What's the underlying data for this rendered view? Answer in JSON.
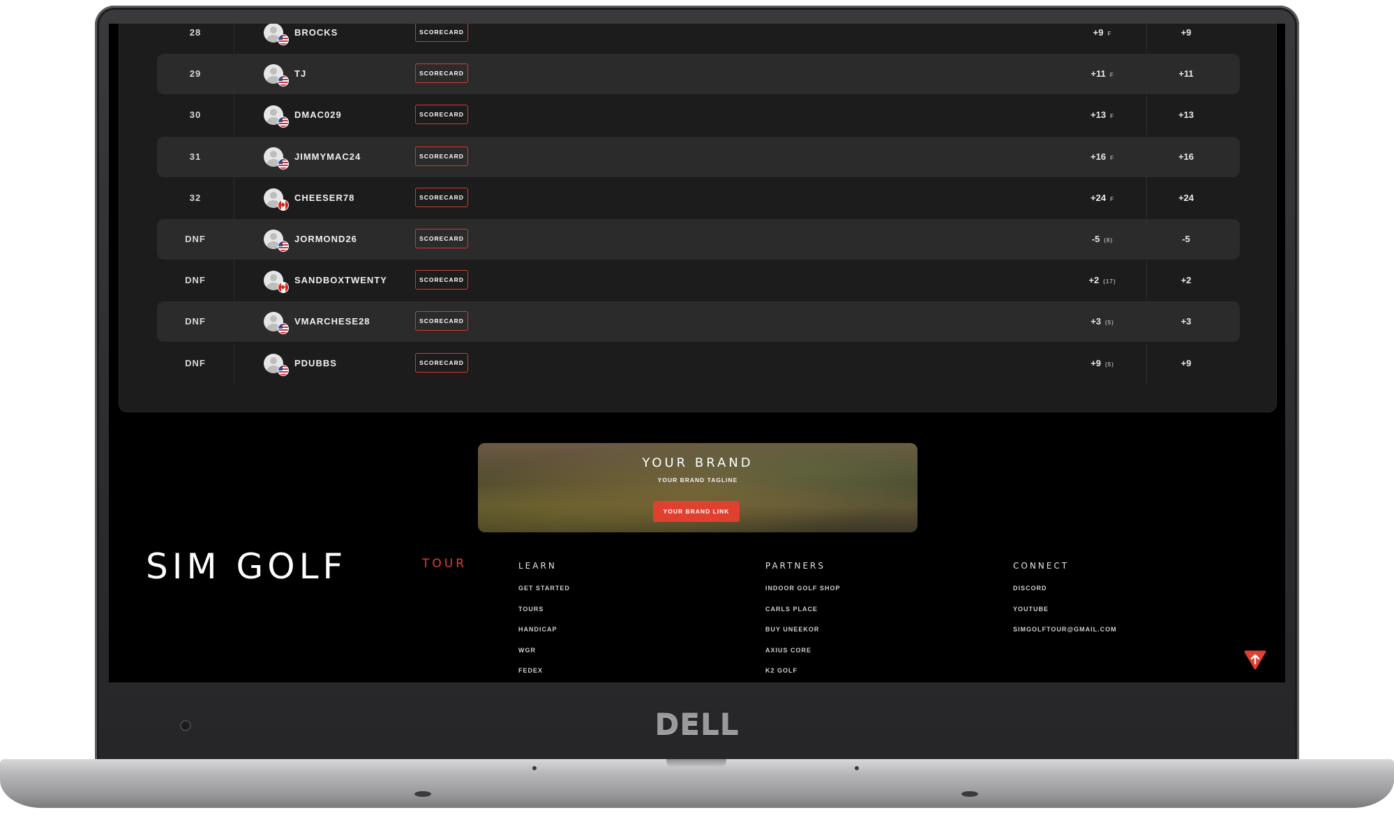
{
  "leaderboard": {
    "scorecard_label": "SCORECARD",
    "rows": [
      {
        "pos": "28",
        "name": "BROCKS",
        "flag": "us",
        "score": "+9",
        "sub": "F",
        "total": "+9",
        "alt": false
      },
      {
        "pos": "29",
        "name": "TJ",
        "flag": "us",
        "score": "+11",
        "sub": "F",
        "total": "+11",
        "alt": true
      },
      {
        "pos": "30",
        "name": "DMAC029",
        "flag": "us",
        "score": "+13",
        "sub": "F",
        "total": "+13",
        "alt": false
      },
      {
        "pos": "31",
        "name": "JIMMYMAC24",
        "flag": "us",
        "score": "+16",
        "sub": "F",
        "total": "+16",
        "alt": true
      },
      {
        "pos": "32",
        "name": "CHEESER78",
        "flag": "ca",
        "score": "+24",
        "sub": "F",
        "total": "+24",
        "alt": false
      },
      {
        "pos": "DNF",
        "name": "JORMOND26",
        "flag": "us",
        "score": "-5",
        "sub": "(8)",
        "total": "-5",
        "alt": true
      },
      {
        "pos": "DNF",
        "name": "SANDBOXTWENTY",
        "flag": "ca",
        "score": "+2",
        "sub": "(17)",
        "total": "+2",
        "alt": false
      },
      {
        "pos": "DNF",
        "name": "VMARCHESE28",
        "flag": "us",
        "score": "+3",
        "sub": "(5)",
        "total": "+3",
        "alt": true
      },
      {
        "pos": "DNF",
        "name": "PDUBBS",
        "flag": "us",
        "score": "+9",
        "sub": "(5)",
        "total": "+9",
        "alt": false
      }
    ]
  },
  "brand": {
    "title": "YOUR BRAND",
    "tagline": "YOUR BRAND TAGLINE",
    "link_label": "YOUR BRAND LINK"
  },
  "footer": {
    "logo_main": "SIM GOLF",
    "logo_sub": "TOUR",
    "learn": {
      "heading": "LEARN",
      "links": [
        "GET STARTED",
        "TOURS",
        "HANDICAP",
        "WGR",
        "FEDEX"
      ]
    },
    "partners": {
      "heading": "PARTNERS",
      "links": [
        "INDOOR GOLF SHOP",
        "CARLS PLACE",
        "BUY UNEEKOR",
        "AXIUS CORE",
        "K2 GOLF"
      ]
    },
    "connect": {
      "heading": "CONNECT",
      "links": [
        "DISCORD",
        "YOUTUBE",
        "SIMGOLFTOUR@GMAIL.COM"
      ]
    }
  },
  "device": {
    "brand": "DELL"
  },
  "icons": {
    "scroll_top": "arrow-up-icon",
    "avatar": "user-avatar-icon"
  },
  "colors": {
    "accent": "#e0402f",
    "panel": "#1c1c1c",
    "row_alt": "#2b2b2b"
  }
}
